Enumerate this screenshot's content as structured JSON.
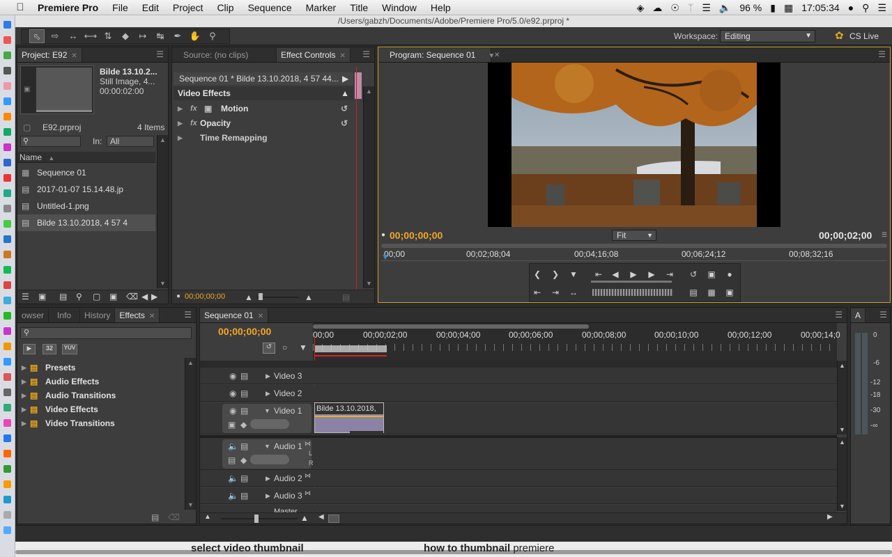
{
  "menubar": {
    "app_name": "Premiere Pro",
    "items": [
      "File",
      "Edit",
      "Project",
      "Clip",
      "Sequence",
      "Marker",
      "Title",
      "Window",
      "Help"
    ],
    "battery": "96 %",
    "clock": "17:05:34"
  },
  "window": {
    "title": "/Users/gabzh/Documents/Adobe/Premiere Pro/5.0/e92.prproj *"
  },
  "toolbar": {
    "workspace_label": "Workspace:",
    "workspace_value": "Editing",
    "cs_live": "CS Live"
  },
  "project_panel": {
    "tab": "Project: E92",
    "clip_name": "Bilde 13.10.2...",
    "clip_type": "Still Image, 4...",
    "clip_duration": "00:00:02:00",
    "project_file": "E92.prproj",
    "item_count": "4 Items",
    "in_label": "In:",
    "in_value": "All",
    "column_name": "Name",
    "items": [
      {
        "label": "Sequence 01",
        "icon": "sequence-icon"
      },
      {
        "label": "2017-01-07 15.14.48.jp",
        "icon": "image-file-icon"
      },
      {
        "label": "Untitled-1.png",
        "icon": "image-file-icon"
      },
      {
        "label": "Bilde 13.10.2018, 4 57 4",
        "icon": "image-file-icon"
      }
    ]
  },
  "effect_controls": {
    "tab_source": "Source: (no clips)",
    "tab_effect": "Effect Controls",
    "sequence_header": "Sequence 01 * Bilde 13.10.2018, 4 57 44...",
    "section": "Video Effects",
    "effects": [
      "Motion",
      "Opacity",
      "Time Remapping"
    ],
    "timecode": "00;00;00;00"
  },
  "program_monitor": {
    "tab": "Program: Sequence 01",
    "timecode_current": "00;00;00;00",
    "timecode_duration": "00;00;02;00",
    "fit": "Fit",
    "ruler": [
      "00;00",
      "00;02;08;04",
      "00;04;16;08",
      "00;06;24;12",
      "00;08;32;16"
    ]
  },
  "effects_panel": {
    "tabs": [
      "owser",
      "Info",
      "History",
      "Effects"
    ],
    "badges": [
      "32",
      "YUV"
    ],
    "folders": [
      "Presets",
      "Audio Effects",
      "Audio Transitions",
      "Video Effects",
      "Video Transitions"
    ]
  },
  "timeline": {
    "tab": "Sequence 01",
    "timecode": "00;00;00;00",
    "ruler": [
      "00;00",
      "00;00;02;00",
      "00;00;04;00",
      "00;00;06;00",
      "00;00;08;00",
      "00;00;10;00",
      "00;00;12;00",
      "00;00;14;0"
    ],
    "video_tracks": [
      "Video 3",
      "Video 2",
      "Video 1"
    ],
    "audio_tracks": [
      "Audio 1",
      "Audio 2",
      "Audio 3",
      "Master"
    ],
    "clip_label": "Bilde 13.10.2018,",
    "audio_channel_l": "L",
    "audio_channel_r": "R"
  },
  "audio_meter": {
    "tab": "A",
    "scale": [
      "0",
      "-6",
      "-12",
      "-18",
      "-30",
      "-∞"
    ]
  },
  "footer": {
    "suggestion_1": "select video thumbnail",
    "suggestion_2": "how to thumbnail premiere",
    "suggestion_2_bold": "how to thumbnail",
    "suggestion_2_rest": "premiere"
  },
  "colors": {
    "accent_orange": "#f5a623",
    "panel_bg": "#3d3d3d",
    "playhead_red": "#d22"
  }
}
